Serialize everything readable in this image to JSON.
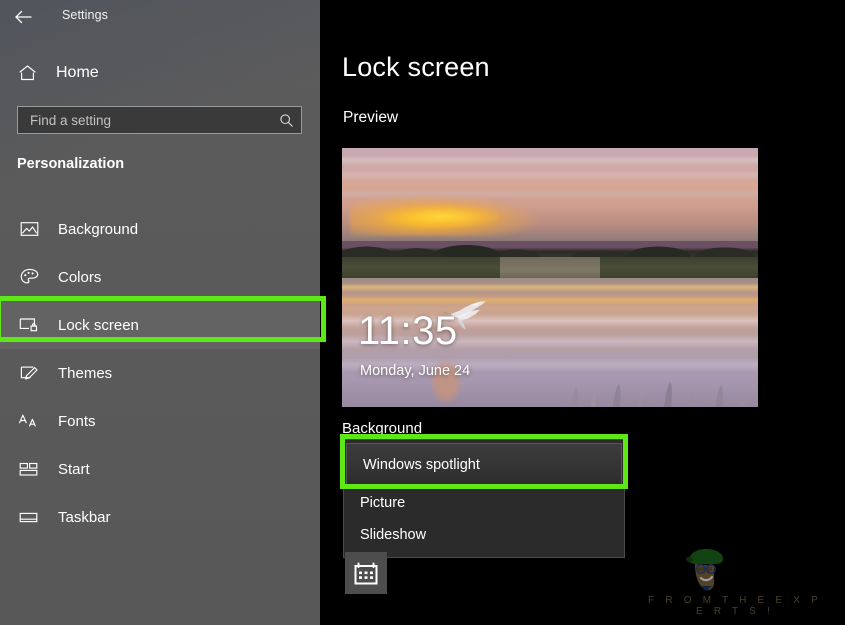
{
  "window": {
    "app_title": "Settings",
    "back_icon": "back-arrow-icon"
  },
  "sidebar": {
    "home": {
      "label": "Home",
      "icon": "home-icon"
    },
    "search": {
      "value": "",
      "placeholder": "Find a setting",
      "icon": "search-icon"
    },
    "section_heading": "Personalization",
    "items": [
      {
        "label": "Background",
        "icon": "picture-icon",
        "selected": false
      },
      {
        "label": "Colors",
        "icon": "palette-icon",
        "selected": false
      },
      {
        "label": "Lock screen",
        "icon": "lock-screen-icon",
        "selected": true
      },
      {
        "label": "Themes",
        "icon": "themes-brush-icon",
        "selected": false
      },
      {
        "label": "Fonts",
        "icon": "fonts-icon",
        "selected": false
      },
      {
        "label": "Start",
        "icon": "start-tiles-icon",
        "selected": false
      },
      {
        "label": "Taskbar",
        "icon": "taskbar-icon",
        "selected": false
      }
    ]
  },
  "main": {
    "page_title": "Lock screen",
    "preview_label": "Preview",
    "lock_preview": {
      "time": "11:35",
      "date": "Monday, June 24",
      "image_description": "Sunset marsh with flying egret"
    },
    "background_section": {
      "label": "Background",
      "dropdown": {
        "selected": "Windows spotlight",
        "options": [
          "Windows spotlight",
          "Picture",
          "Slideshow"
        ],
        "expanded": true
      }
    },
    "calendar_tile": {
      "icon": "calendar-icon"
    }
  },
  "annotations": {
    "highlight_color": "#5fe817",
    "boxes": [
      {
        "target": "sidebar-item-lock-screen"
      },
      {
        "target": "dropdown-option-windows-spotlight"
      }
    ]
  },
  "watermark": {
    "text": "F R O M   T H E   E X P E R T S !",
    "logo": "expert-mascot-icon"
  },
  "colors": {
    "sidebar_bg": "#5a5a5a",
    "main_bg": "#000000",
    "dropdown_bg": "#2b2b2b",
    "selected_nav_bg": "#636363",
    "accent_green": "#5fe817"
  }
}
